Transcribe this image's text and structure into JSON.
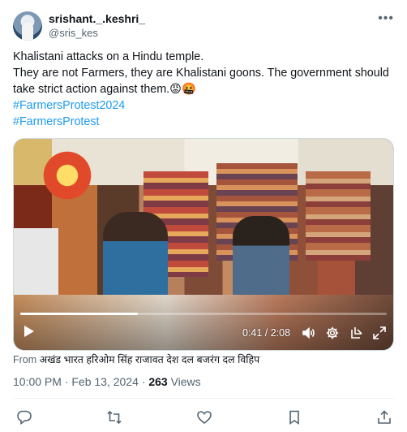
{
  "author": {
    "display_name": "srishant._.keshri_",
    "handle": "@sris_kes"
  },
  "tweet": {
    "lines": [
      "Khalistani attacks on a Hindu temple.",
      "They are not Farmers, they are Khalistani goons. The government should",
      "take strict action against them.😡🤬"
    ],
    "hashtags": [
      "#FarmersProtest2024",
      "#FarmersProtest"
    ]
  },
  "video": {
    "elapsed": "0:41",
    "duration": "2:08",
    "time_display": "0:41 / 2:08",
    "progress_fraction": 0.32
  },
  "source": {
    "prefix": "From",
    "name": "अखंड भारत हरिओम सिंह राजावत देश दल बजरंग दल विहिप"
  },
  "meta": {
    "timestamp": "10:00 PM · Feb 13, 2024 · ",
    "views_count": "263",
    "views_label": " Views"
  },
  "icons": {
    "more": "more-icon",
    "play": "play-icon",
    "volume": "volume-icon",
    "settings": "gear-icon",
    "popout": "popout-icon",
    "fullscreen": "fullscreen-icon",
    "reply": "reply-icon",
    "retweet": "retweet-icon",
    "like": "heart-icon",
    "bookmark": "bookmark-icon",
    "share": "share-icon"
  },
  "colors": {
    "text": "#0f1419",
    "secondary": "#536471",
    "link": "#1d9bf0",
    "border": "#cfd9de"
  }
}
